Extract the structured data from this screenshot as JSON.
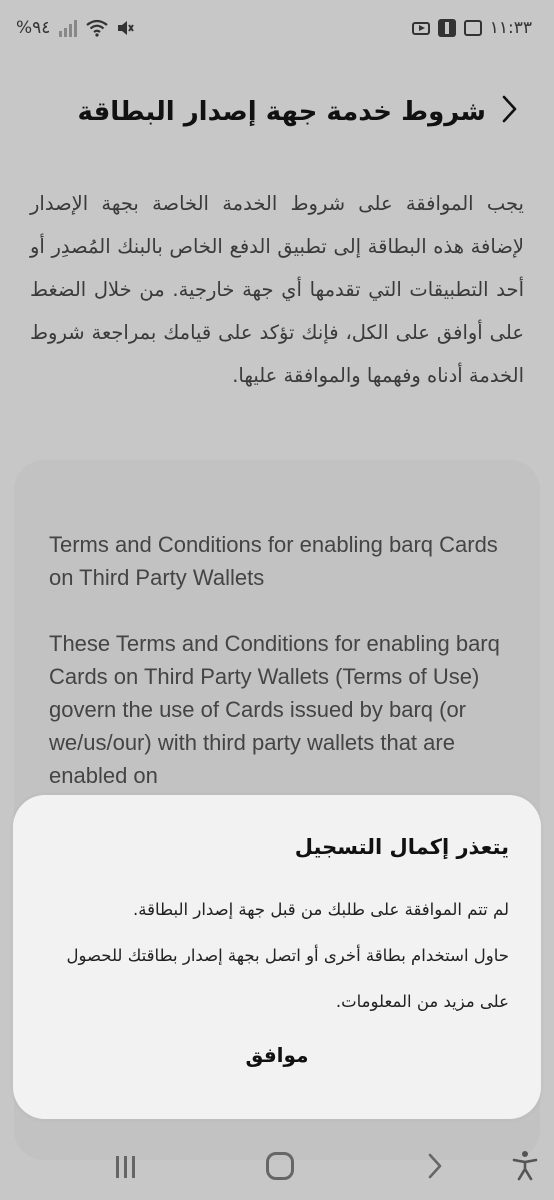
{
  "status_bar": {
    "time": "١١:٣٣",
    "battery": "%٩٤",
    "icons": [
      "youtube-icon",
      "app-icon",
      "shopping-bag-icon",
      "mute-icon",
      "wifi-icon",
      "signal-icon"
    ]
  },
  "header": {
    "title": "شروط خدمة جهة إصدار البطاقة",
    "back_icon": "chevron-back-icon"
  },
  "intro_text": "يجب الموافقة على شروط الخدمة الخاصة بجهة الإصدار لإضافة هذه البطاقة إلى تطبيق الدفع الخاص بالبنك المُصدِر أو أحد التطبيقات التي تقدمها أي جهة خارجية. من خلال الضغط على أوافق على الكل، فإنك تؤكد على قيامك بمراجعة شروط الخدمة أدناه وفهمها والموافقة عليها.",
  "terms": {
    "heading": "Terms and Conditions for enabling barq Cards on Third Party Wallets",
    "body": "These Terms and Conditions for enabling barq Cards on Third Party Wallets (Terms of Use) govern the use of Cards issued by barq (or we/us/our) with third party wallets that are enabled on"
  },
  "dialog": {
    "title": "يتعذر إكمال التسجيل",
    "message_line1": "لم تتم الموافقة على طلبك من قبل جهة إصدار البطاقة.",
    "message_line2": "حاول استخدام بطاقة أخرى أو اتصل بجهة إصدار بطاقتك للحصول على مزيد من المعلومات.",
    "ok_label": "موافق"
  },
  "nav_bar": {
    "icons": [
      "recents-icon",
      "home-icon",
      "back-icon",
      "accessibility-icon"
    ]
  }
}
